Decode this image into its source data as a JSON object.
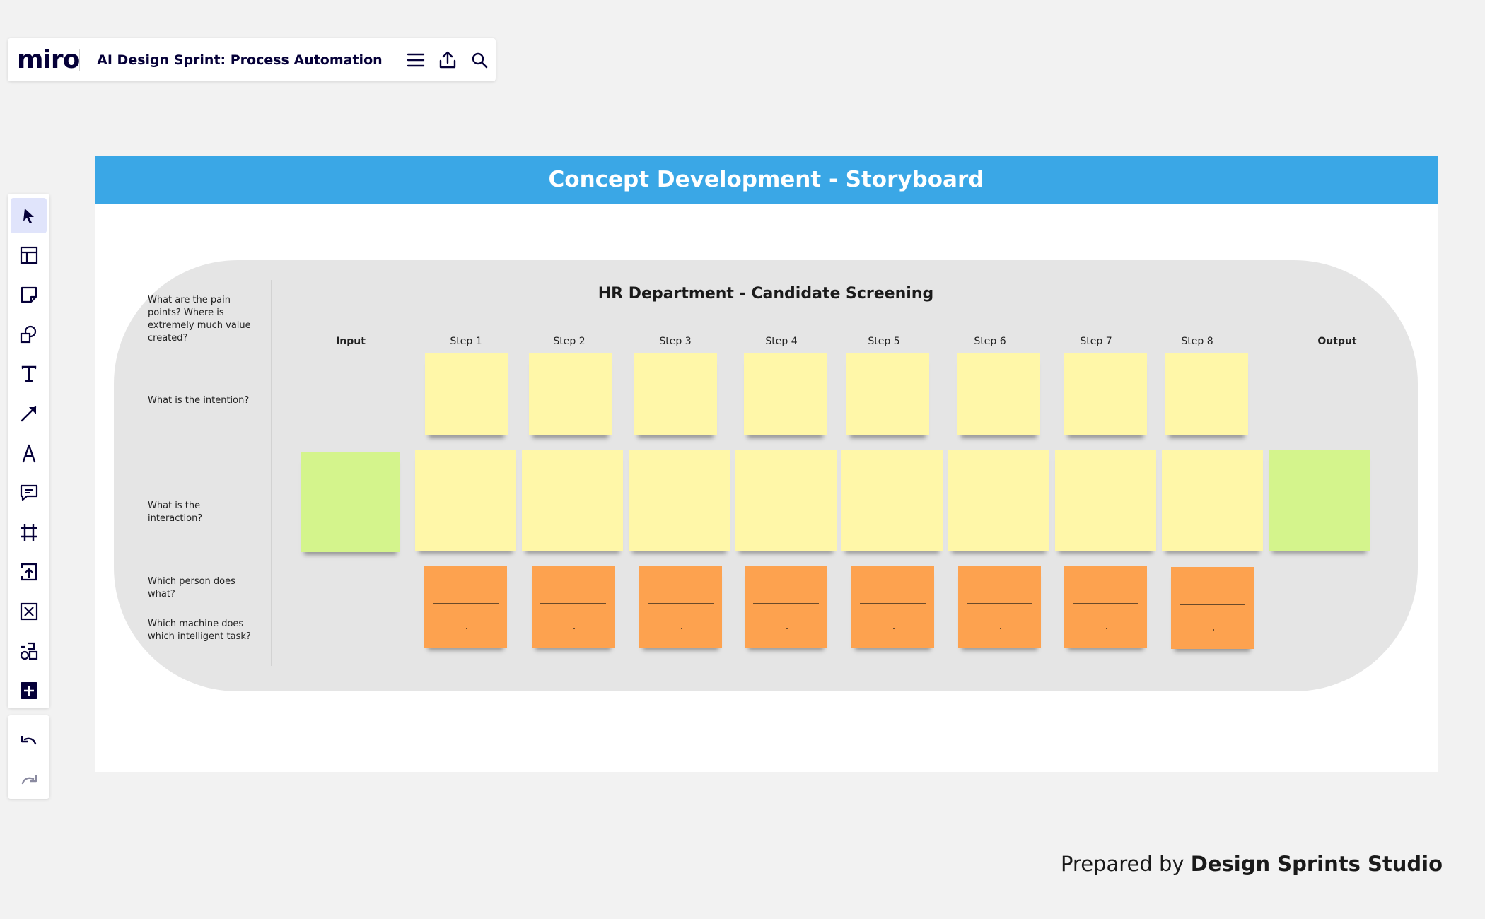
{
  "app": {
    "logo": "miro",
    "board_title": "AI Design Sprint: Process Automation"
  },
  "topbar_icons": [
    "menu-icon",
    "export-icon",
    "search-icon"
  ],
  "toolbar": {
    "tools": [
      "select-icon",
      "templates-icon",
      "sticky-note-icon",
      "shapes-icon",
      "text-icon",
      "connection-line-icon",
      "pen-icon",
      "comment-icon",
      "frame-icon",
      "upload-icon",
      "embed-icon",
      "more-apps-icon",
      "add-icon"
    ],
    "active": "select-icon",
    "history": [
      "undo-icon",
      "redo-icon"
    ]
  },
  "frame": {
    "title": "Concept Development - Storyboard",
    "header_color": "#3aa7e6"
  },
  "storyboard": {
    "title": "HR Department - Candidate Screening",
    "questions": [
      "What are the pain points? Where is extremely much value created?",
      "What is the intention?",
      "What is the interaction?",
      "Which person does what?",
      "Which machine does which intelligent task?"
    ],
    "columns": [
      "Input",
      "Step 1",
      "Step 2",
      "Step 3",
      "Step 4",
      "Step 5",
      "Step 6",
      "Step 7",
      "Step 8",
      "Output"
    ],
    "note_colors": {
      "yellow": "#fff7a8",
      "green": "#d4f48c",
      "orange": "#fda24f"
    }
  },
  "footer": {
    "prefix": "Prepared by ",
    "brand": "Design Sprints Studio"
  }
}
